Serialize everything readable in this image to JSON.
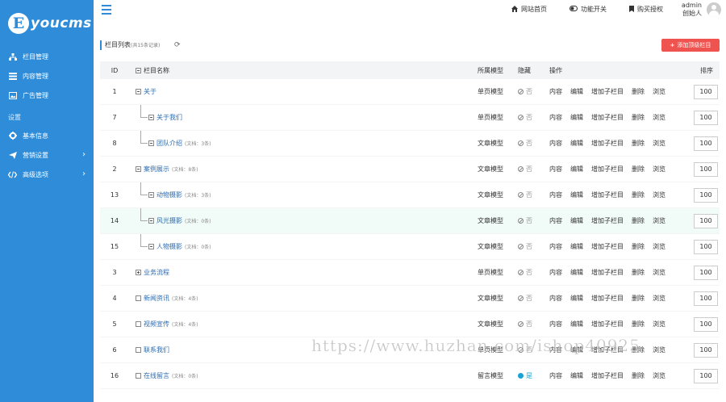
{
  "logo": {
    "letter": "E",
    "text": "youcms"
  },
  "sidebar": {
    "items": [
      {
        "label": "栏目管理",
        "icon": "sitemap-icon"
      },
      {
        "label": "内容管理",
        "icon": "list-icon"
      },
      {
        "label": "广告管理",
        "icon": "image-icon"
      }
    ],
    "group_title": "设置",
    "settings": [
      {
        "label": "基本信息",
        "icon": "gear-icon"
      },
      {
        "label": "营销设置",
        "icon": "send-icon"
      },
      {
        "label": "高级选项",
        "icon": "code-icon"
      }
    ]
  },
  "topbar": {
    "home": "网站首页",
    "toggle": "功能开关",
    "buy": "购买授权",
    "user_name": "admin",
    "user_role": "创始人"
  },
  "main": {
    "list_title": "栏目列表",
    "list_count": "(共15条记录)",
    "add_button": "添加顶级栏目",
    "headers": {
      "id": "ID",
      "name": "栏目名称",
      "model": "所属模型",
      "hide": "隐藏",
      "ops": "操作",
      "sort": "排序"
    },
    "ops": [
      "内容",
      "编辑",
      "增加子栏目",
      "删除",
      "浏览"
    ],
    "rows": [
      {
        "id": "1",
        "name": "关于",
        "count": "",
        "level": 0,
        "box": "minus",
        "model": "单页模型",
        "hide": "否",
        "hidden": false,
        "sort": "100"
      },
      {
        "id": "7",
        "name": "关于我们",
        "count": "",
        "level": 1,
        "box": "minus",
        "model": "单页模型",
        "hide": "否",
        "hidden": false,
        "sort": "100"
      },
      {
        "id": "8",
        "name": "团队介绍",
        "count": "(文档：3条)",
        "level": 1,
        "box": "minus",
        "model": "文章模型",
        "hide": "否",
        "hidden": false,
        "sort": "100"
      },
      {
        "id": "2",
        "name": "案例展示",
        "count": "(文档：8条)",
        "level": 0,
        "box": "minus",
        "model": "文章模型",
        "hide": "否",
        "hidden": false,
        "sort": "100"
      },
      {
        "id": "13",
        "name": "动物摄影",
        "count": "(文档：3条)",
        "level": 1,
        "box": "minus",
        "model": "文章模型",
        "hide": "否",
        "hidden": false,
        "sort": "100"
      },
      {
        "id": "14",
        "name": "风光摄影",
        "count": "(文档：0条)",
        "level": 1,
        "box": "minus",
        "model": "文章模型",
        "hide": "否",
        "hidden": false,
        "sort": "100",
        "highlight": true
      },
      {
        "id": "15",
        "name": "人物摄影",
        "count": "(文档：0条)",
        "level": 1,
        "box": "minus",
        "model": "文章模型",
        "hide": "否",
        "hidden": false,
        "sort": "100"
      },
      {
        "id": "3",
        "name": "业务流程",
        "count": "",
        "level": 0,
        "box": "plus",
        "model": "单页模型",
        "hide": "否",
        "hidden": false,
        "sort": "100"
      },
      {
        "id": "4",
        "name": "新闻资讯",
        "count": "(文档：4条)",
        "level": 0,
        "box": "empty",
        "model": "文章模型",
        "hide": "否",
        "hidden": false,
        "sort": "100"
      },
      {
        "id": "5",
        "name": "视频宣传",
        "count": "(文档：4条)",
        "level": 0,
        "box": "empty",
        "model": "文章模型",
        "hide": "否",
        "hidden": false,
        "sort": "100"
      },
      {
        "id": "6",
        "name": "联系我们",
        "count": "",
        "level": 0,
        "box": "empty",
        "model": "单页模型",
        "hide": "否",
        "hidden": false,
        "sort": "100"
      },
      {
        "id": "16",
        "name": "在线留言",
        "count": "(文档：0条)",
        "level": 0,
        "box": "empty",
        "model": "留言模型",
        "hide": "是",
        "hidden": true,
        "sort": "100"
      }
    ]
  },
  "watermark": "https://www.huzhan.com/ishop40925",
  "colors": {
    "sidebar": "#2e8cd9",
    "accent": "#ef5350",
    "link": "#2b6cb3"
  }
}
